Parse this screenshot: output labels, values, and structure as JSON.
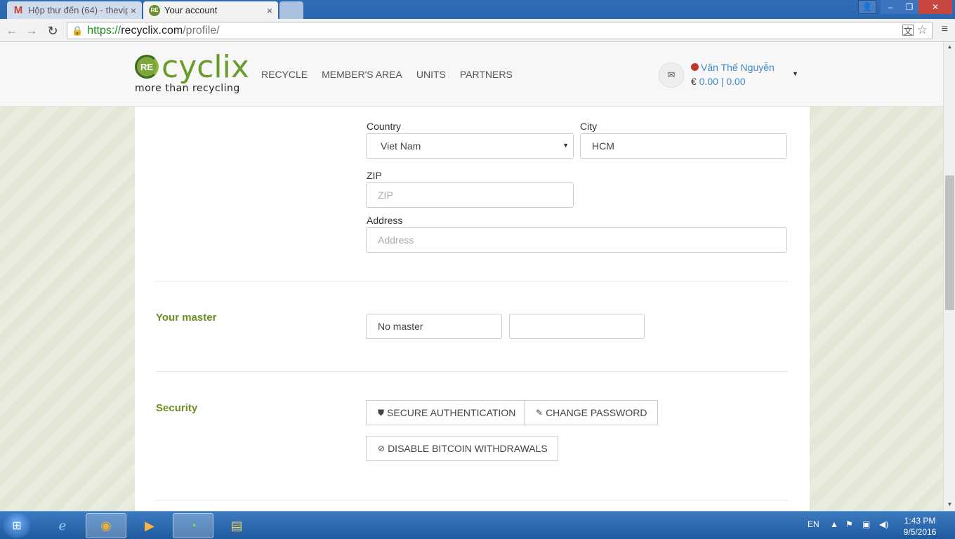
{
  "browser": {
    "tabs": [
      {
        "label": "Hộp thư đến (64) - thevip",
        "active": false
      },
      {
        "label": "Your account",
        "active": true
      }
    ],
    "url": {
      "scheme": "https://",
      "host": "recyclix.com",
      "path": "/profile/"
    }
  },
  "header": {
    "logo": {
      "badge": "RE",
      "word": "cyclix",
      "tagline": "more than recycling"
    },
    "nav": [
      "RECYCLE",
      "MEMBER'S AREA",
      "UNITS",
      "PARTNERS"
    ],
    "user": {
      "name": "Văn Thế Nguyễn",
      "currency": "€",
      "balance_a": "0.00",
      "separator": "|",
      "balance_b": "0.00"
    }
  },
  "form": {
    "country": {
      "label": "Country",
      "value": "Viet Nam"
    },
    "city": {
      "label": "City",
      "value": "HCM"
    },
    "zip": {
      "label": "ZIP",
      "placeholder": "ZIP"
    },
    "address": {
      "label": "Address",
      "placeholder": "Address"
    }
  },
  "master": {
    "title": "Your master",
    "value": "No master",
    "value2": ""
  },
  "security": {
    "title": "Security",
    "buttons": [
      "SECURE AUTHENTICATION",
      "CHANGE PASSWORD",
      "DISABLE BITCOIN WITHDRAWALS"
    ]
  },
  "taskbar": {
    "lang": "EN",
    "time": "1:43 PM",
    "date": "9/5/2016"
  },
  "colors": {
    "brand_green": "#6b8e23",
    "link_blue": "#3d8ac9",
    "status_red": "#c0392b"
  }
}
